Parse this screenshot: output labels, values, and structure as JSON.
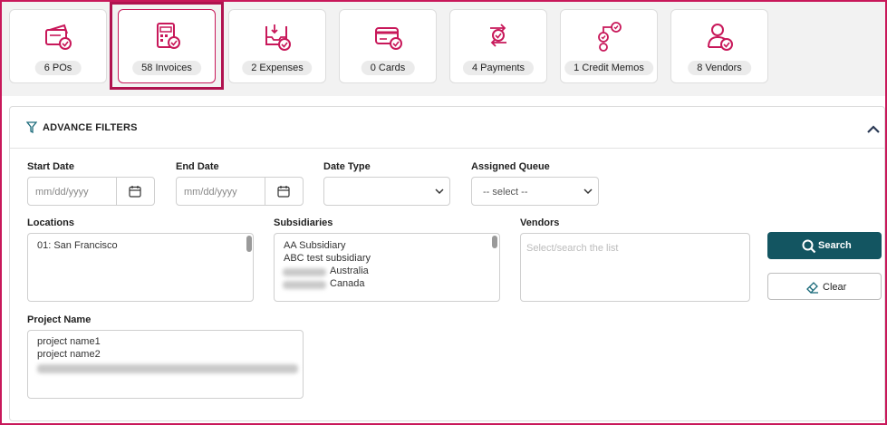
{
  "tiles": [
    {
      "label": "6 POs",
      "icon": "purchase-orders-icon"
    },
    {
      "label": "58 Invoices",
      "icon": "invoice-calculator-icon"
    },
    {
      "label": "2 Expenses",
      "icon": "expenses-tray-icon"
    },
    {
      "label": "0 Cards",
      "icon": "credit-card-icon"
    },
    {
      "label": "4 Payments",
      "icon": "payments-exchange-icon"
    },
    {
      "label": "1 Credit Memos",
      "icon": "credit-memo-icon"
    },
    {
      "label": "8 Vendors",
      "icon": "vendor-person-icon"
    }
  ],
  "active_tile": "58 Invoices",
  "colors": {
    "accent": "#c8185a",
    "primary_button": "#135561",
    "filter_icon": "#1a6a7a"
  },
  "filters": {
    "title": "ADVANCE FILTERS",
    "start_date": {
      "label": "Start Date",
      "placeholder": "mm/dd/yyyy"
    },
    "end_date": {
      "label": "End Date",
      "placeholder": "mm/dd/yyyy"
    },
    "date_type": {
      "label": "Date Type",
      "value": ""
    },
    "assigned_queue": {
      "label": "Assigned Queue",
      "value": "-- select --"
    },
    "locations": {
      "label": "Locations",
      "items": [
        "01: San Francisco"
      ]
    },
    "subsidiaries": {
      "label": "Subsidiaries",
      "items": [
        "AA Subsidiary",
        "ABC test subsidiary",
        "Australia",
        "Canada"
      ]
    },
    "vendors": {
      "label": "Vendors",
      "placeholder": "Select/search the list"
    },
    "project_name": {
      "label": "Project Name",
      "items": [
        "project name1",
        "project name2"
      ]
    }
  },
  "buttons": {
    "search": "Search",
    "clear": "Clear"
  }
}
